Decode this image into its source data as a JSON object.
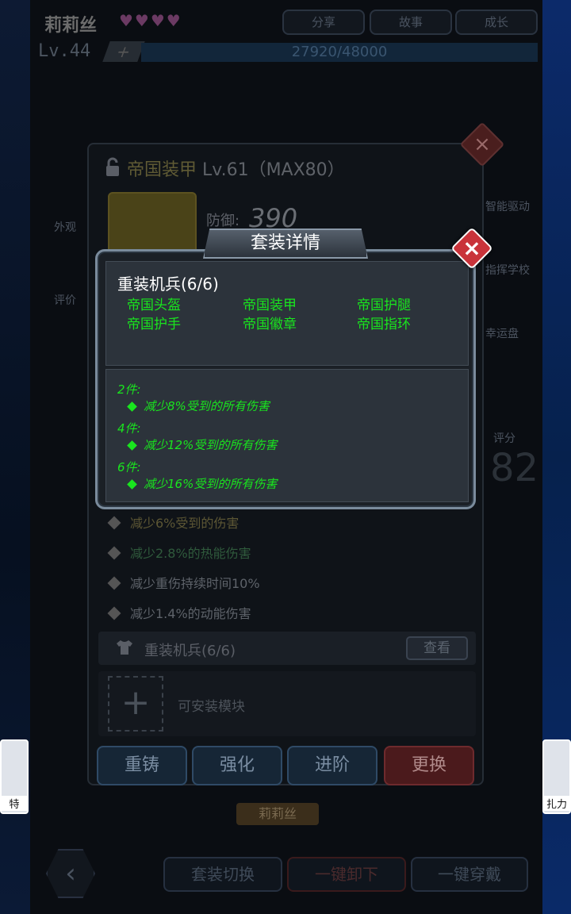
{
  "header": {
    "character_name": "莉莉丝",
    "tabs": [
      "分享",
      "故事",
      "成长"
    ],
    "level": "Lv.44",
    "xp": "27920/48000"
  },
  "side_menu": {
    "appearance": "外观",
    "comment": "评价",
    "right_items": [
      "智能驱动",
      "指挥学校",
      "幸运盘"
    ],
    "score_label": "评分",
    "score_value": "82"
  },
  "equip_panel": {
    "item_name": "帝国装甲",
    "item_level": "Lv.61（MAX80）",
    "defense_label": "防御:",
    "defense_value": "390",
    "stats": [
      "减少6%受到的伤害",
      "减少2.8%的热能伤害",
      "减少重伤持续时间10%",
      "减少1.4%的动能伤害"
    ],
    "suit_label": "重装机兵(6/6)",
    "view_button": "查看",
    "module_label": "可安装模块",
    "buttons": [
      "重铸",
      "强化",
      "进阶",
      "更换"
    ]
  },
  "bottom_bar": {
    "character_plate": "莉莉丝",
    "set_switch": "套装切换",
    "unequip_all": "一键卸下",
    "equip_all": "一键穿戴",
    "left_portrait_caption": "特",
    "right_portrait_caption": "扎力"
  },
  "modal": {
    "title": "套装详情",
    "set_name": "重装机兵(6/6)",
    "pieces": [
      "帝国头盔",
      "帝国装甲",
      "帝国护腿",
      "帝国护手",
      "帝国徽章",
      "帝国指环"
    ],
    "bonuses": [
      {
        "label": "2件:",
        "effect": "减少8%受到的所有伤害"
      },
      {
        "label": "4件:",
        "effect": "减少12%受到的所有伤害"
      },
      {
        "label": "6件:",
        "effect": "减少16%受到的所有伤害"
      }
    ],
    "close_icon": "close-icon"
  },
  "colors": {
    "bonus_green": "#19e51e",
    "close_red": "#c9333a"
  }
}
